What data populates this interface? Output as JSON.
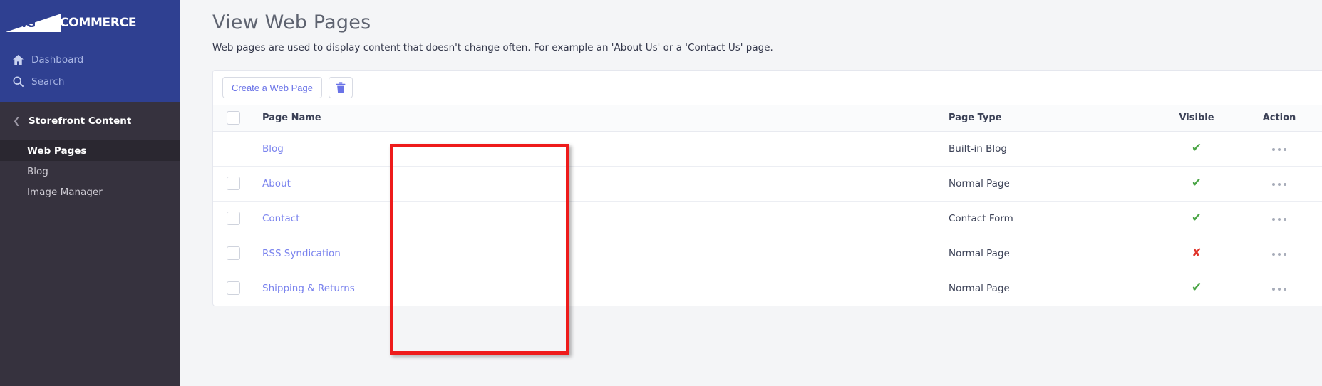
{
  "brand": {
    "logo_mark_text": "BIG",
    "logo_word": "COMMERCE",
    "primary_color": "#2f4091",
    "sidebar_color": "#36323e",
    "link_color": "#7b84ee",
    "visible_yes_color": "#4aa545",
    "visible_no_color": "#e0342b",
    "annotation_color": "#ee1b1b"
  },
  "sidebar": {
    "top_items": [
      {
        "label": "Dashboard",
        "icon": "home-icon"
      },
      {
        "label": "Search",
        "icon": "search-icon"
      }
    ],
    "section": {
      "label": "Storefront Content",
      "back_icon": "chevron-left-icon"
    },
    "items": [
      {
        "label": "Web Pages",
        "active": true
      },
      {
        "label": "Blog",
        "active": false
      },
      {
        "label": "Image Manager",
        "active": false
      }
    ]
  },
  "header": {
    "title": "View Web Pages",
    "subtitle": "Web pages are used to display content that doesn't change often. For example an 'About Us' or a 'Contact Us' page."
  },
  "toolbar": {
    "create_label": "Create a Web Page",
    "delete_icon": "trash-icon"
  },
  "table": {
    "columns": {
      "select": "",
      "page_name": "Page Name",
      "page_type": "Page Type",
      "visible": "Visible",
      "action": "Action"
    },
    "rows": [
      {
        "name": "Blog",
        "type": "Built-in Blog",
        "visible": "✔",
        "visible_state": "yes",
        "has_checkbox": false,
        "action_icon": "ellipsis-icon"
      },
      {
        "name": "About",
        "type": "Normal Page",
        "visible": "✔",
        "visible_state": "yes",
        "has_checkbox": true,
        "action_icon": "ellipsis-icon"
      },
      {
        "name": "Contact",
        "type": "Contact Form",
        "visible": "✔",
        "visible_state": "yes",
        "has_checkbox": true,
        "action_icon": "ellipsis-icon"
      },
      {
        "name": "RSS Syndication",
        "type": "Normal Page",
        "visible": "✘",
        "visible_state": "no",
        "has_checkbox": true,
        "action_icon": "ellipsis-icon"
      },
      {
        "name": "Shipping & Returns",
        "type": "Normal Page",
        "visible": "✔",
        "visible_state": "yes",
        "has_checkbox": true,
        "action_icon": "ellipsis-icon"
      }
    ]
  },
  "annotation": {
    "shape": "rectangle-highlight",
    "target": "page-name-column"
  }
}
